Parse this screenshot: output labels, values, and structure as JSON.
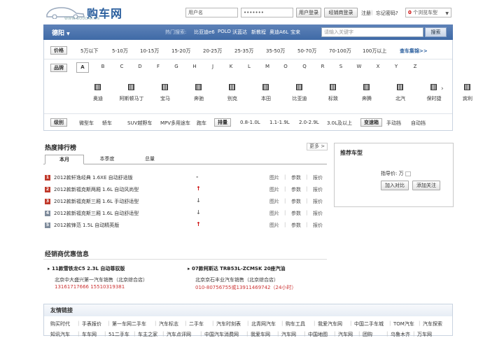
{
  "header": {
    "logo_text": "购车网",
    "logo_sub": "WWW.GOUCAR.CN",
    "username_value": "用户名",
    "password_value": "•••••••",
    "login_label": "用户登录",
    "dealer_login_label": "经销商登录",
    "register_label": "注册",
    "forgot_label": "忘记密码?",
    "browse_count": "0",
    "browse_label": "个浏览车型"
  },
  "nav": {
    "city": "德阳",
    "hot_label": "热门搜索:",
    "hot_items": [
      "比亚迪e6",
      "POLO",
      "沃蓝达",
      "新教程",
      "奥迪A6L",
      "宝来"
    ],
    "search_placeholder": "请输入关键字",
    "search_button": "搜索"
  },
  "filters": {
    "price_label": "价格",
    "price_options": [
      "5万以下",
      "5-10万",
      "10-15万",
      "15-20万",
      "20-25万",
      "25-35万",
      "35-50万",
      "50-70万",
      "70-100万",
      "100万以上"
    ],
    "price_more": "查车集锦>>",
    "brand_label": "品牌",
    "letters": [
      "A",
      "B",
      "C",
      "D",
      "F",
      "G",
      "H",
      "J",
      "K",
      "L",
      "M",
      "O",
      "Q",
      "R",
      "S",
      "W",
      "X",
      "Y",
      "Z"
    ],
    "brands": [
      "奥迪",
      "阿斯顿马丁",
      "宝马",
      "奔驰",
      "别克",
      "本田",
      "比亚迪",
      "标致",
      "奔腾",
      "北汽",
      "保时捷",
      "宾利"
    ],
    "level_label": "级别",
    "level_options": [
      "微型车",
      "轿车",
      "SUV越野车",
      "MPV多用途车",
      "跑车"
    ],
    "displacement_label": "排量",
    "displacement_options": [
      "0.8-1.0L",
      "1.1-1.9L",
      "2.0-2.9L",
      "3.0L及以上"
    ],
    "gearbox_label": "变速箱",
    "gearbox_options": [
      "手动挡",
      "自动挡"
    ]
  },
  "ranking": {
    "title": "热度排行榜",
    "more": "更多 >",
    "tabs": [
      "本月",
      "本季度",
      "总量"
    ],
    "rows": [
      {
        "rank": "1",
        "title": "2012款轩逸经典  1.6XE 自动舒适版",
        "trend": "-",
        "color": "#c0392b"
      },
      {
        "rank": "2",
        "title": "2012款新福克斯两厢  1.6L 自动风尚型",
        "trend": "↑",
        "color": "#c0392b"
      },
      {
        "rank": "3",
        "title": "2012款新福克斯三厢  1.6L 手动舒适型",
        "trend": "↓",
        "color": "#c0392b"
      },
      {
        "rank": "4",
        "title": "2012款新福克斯三厢  1.6L 自动舒适型",
        "trend": "↓",
        "color": "#7f8c9c"
      },
      {
        "rank": "5",
        "title": "2012款锋范  1.5L 自动精英版",
        "trend": "↑",
        "color": "#7f8c9c"
      }
    ],
    "link_pic": "图片",
    "link_param": "参数",
    "link_price": "报价"
  },
  "recommend": {
    "title": "推荐车型",
    "price_label": "指导价: 万",
    "compare_label": "加入对比",
    "follow_label": "添加关注"
  },
  "dealers": {
    "title": "经销商优惠信息",
    "items": [
      {
        "headline": "11款雪铁龙C5 2.3L 自动尊驭版",
        "dealer": "北京中大盛兴第一汽车销售（北京综合店）",
        "phone": "13161717666 15510319381"
      },
      {
        "headline": "07款柯斯达 TRB53L-ZCMSK 20座汽油",
        "dealer": "北京京石丰业汽车销售（北京综合店）",
        "phone": "010-80756755或13911469742（24小时）"
      }
    ]
  },
  "friends": {
    "title": "友情链接",
    "row1": [
      "购买时代",
      "手表报价",
      "第一车网二手车",
      "汽车标志",
      "二手车",
      "汽车时刻表",
      "北青网汽车",
      "购车工具",
      "我爱汽车网",
      "中国二手车城",
      "TOM汽车",
      "汽车探索"
    ],
    "row2": [
      "知讯汽车",
      "车车网",
      "51二手车",
      "车主之家",
      "汽车点评网",
      "中国汽车消费网",
      "我爱车网",
      "汽车网",
      "中国地图",
      "汽车网",
      "团购",
      "乌鲁木齐",
      "万车网"
    ]
  },
  "colors": {
    "brand_blue": "#2b5f9e",
    "nav_blue": "#4a72ad",
    "red": "#c00"
  }
}
